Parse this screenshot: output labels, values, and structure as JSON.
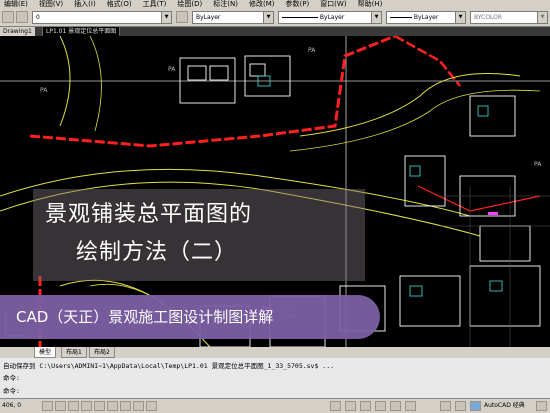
{
  "menu": {
    "items": [
      "编辑(E)",
      "视图(V)",
      "插入(I)",
      "格式(O)",
      "工具(T)",
      "绘图(D)",
      "标注(N)",
      "修改(M)",
      "参数(P)",
      "窗口(W)",
      "帮助(H)"
    ]
  },
  "toolbar": {
    "layer_value": "0",
    "color_value": "ByLayer",
    "linetype_value": "ByLayer",
    "lineweight_value": "ByLayer",
    "plotstyle_value": "BYCOLOR"
  },
  "doc_tabs": {
    "tab1": "Drawing1",
    "tab2": "LP1.01 景观定位总平面图"
  },
  "overlay": {
    "title_line1": "景观铺装总平面图的",
    "title_line2": "绘制方法（二）",
    "subtitle": "CAD（天正）景观施工图设计制图详解"
  },
  "drawing_labels": {
    "pa": "PA"
  },
  "layout_tabs": [
    "模型",
    "布局1",
    "布局2"
  ],
  "command": {
    "line1": "自动保存到 C:\\Users\\ADMINI~1\\AppData\\Local\\Temp\\LP1.01 景观定位总平面图_1_33_5705.sv$ ...",
    "line2": "命令:",
    "line3": "命令:"
  },
  "status": {
    "coords": "406, 0",
    "workspace": "AutoCAD 经典"
  },
  "colors": {
    "background": "#000000",
    "chrome": "#d4d0c8",
    "banner_purple": "#7b5fa4",
    "cad_red": "#ff2020",
    "cad_yellow": "#e0e040",
    "cad_cyan": "#40e0e0",
    "cad_white": "#ffffff"
  }
}
